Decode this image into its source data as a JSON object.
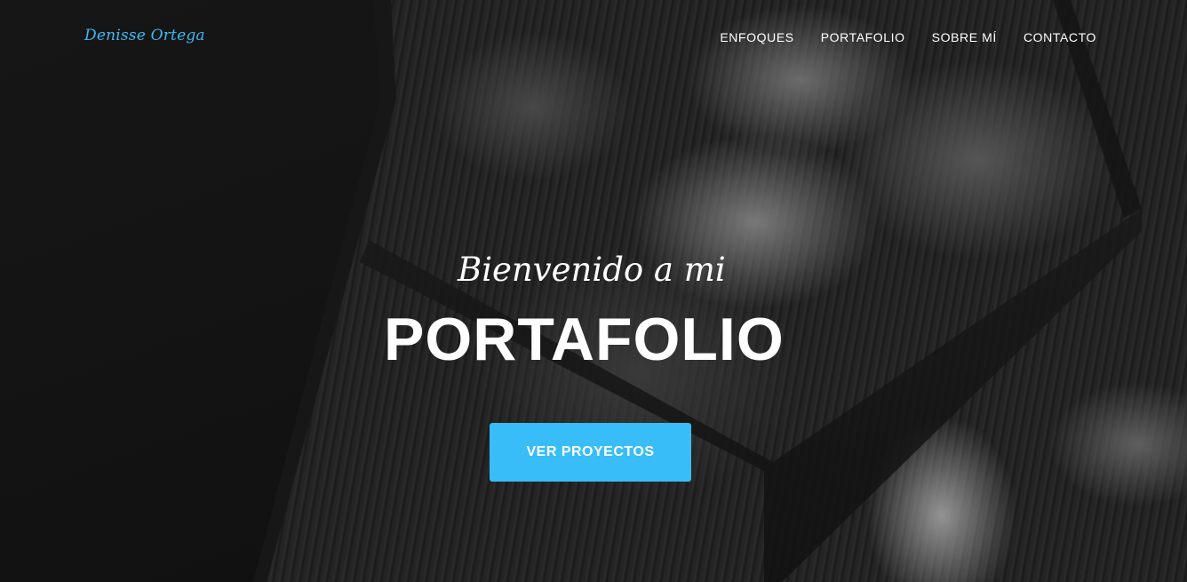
{
  "navbar": {
    "brand": "Denisse Ortega",
    "links": [
      {
        "label": "ENFOQUES"
      },
      {
        "label": "PORTAFOLIO"
      },
      {
        "label": "SOBRE MÍ"
      },
      {
        "label": "CONTACTO"
      }
    ]
  },
  "hero": {
    "subtitle": "Bienvenido a mi",
    "title": "PORTAFOLIO",
    "cta_label": "VER PROYECTOS"
  },
  "colors": {
    "accent": "#38bdf8",
    "brand": "#3db9f5",
    "text": "#ffffff"
  }
}
